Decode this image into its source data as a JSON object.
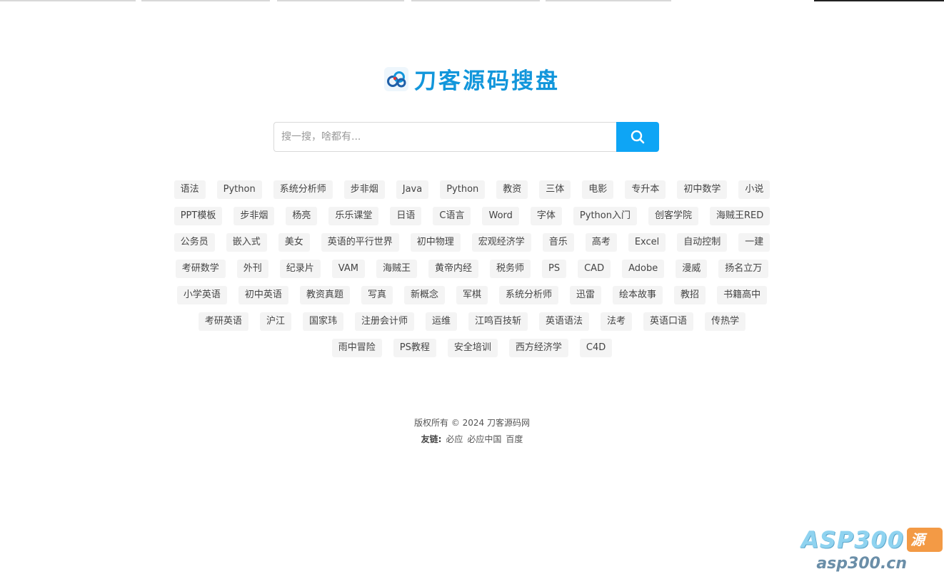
{
  "site": {
    "logo_text": "刀客源码搜盘",
    "brand_color": "#1296db"
  },
  "search": {
    "placeholder": "搜一搜，啥都有...",
    "value": "",
    "button_icon": "search-icon",
    "button_color": "#0ea5f5"
  },
  "tags": [
    "语法",
    "Python",
    "系统分析师",
    "步非烟",
    "Java",
    "Python",
    "教资",
    "三体",
    "电影",
    "专升本",
    "初中数学",
    "小说",
    "PPT模板",
    "步非烟",
    "杨亮",
    "乐乐课堂",
    "日语",
    "C语言",
    "Word",
    "字体",
    "Python入门",
    "创客学院",
    "海贼王RED",
    "公务员",
    "嵌入式",
    "美女",
    "英语的平行世界",
    "初中物理",
    "宏观经济学",
    "音乐",
    "高考",
    "Excel",
    "自动控制",
    "一建",
    "考研数学",
    "外刊",
    "纪录片",
    "VAM",
    "海贼王",
    "黄帝内经",
    "税务师",
    "PS",
    "CAD",
    "Adobe",
    "漫威",
    "扬名立万",
    "小学英语",
    "初中英语",
    "教资真题",
    "写真",
    "新概念",
    "军棋",
    "系统分析师",
    "迅雷",
    "绘本故事",
    "教招",
    "书籍高中",
    "考研英语",
    "沪江",
    "国家玮",
    "注册会计师",
    "运维",
    "江鸣百技斩",
    "英语语法",
    "法考",
    "英语口语",
    "传热学",
    "雨中冒险",
    "PS教程",
    "安全培训",
    "西方经济学",
    "C4D"
  ],
  "footer": {
    "copyright": "版权所有 © 2024 刀客源码网",
    "friends_label": "友链:",
    "links": [
      "必应",
      "必应中国",
      "百度"
    ]
  },
  "watermark": {
    "brand": "ASP300",
    "badge": "源码",
    "url": "asp300.cn"
  }
}
